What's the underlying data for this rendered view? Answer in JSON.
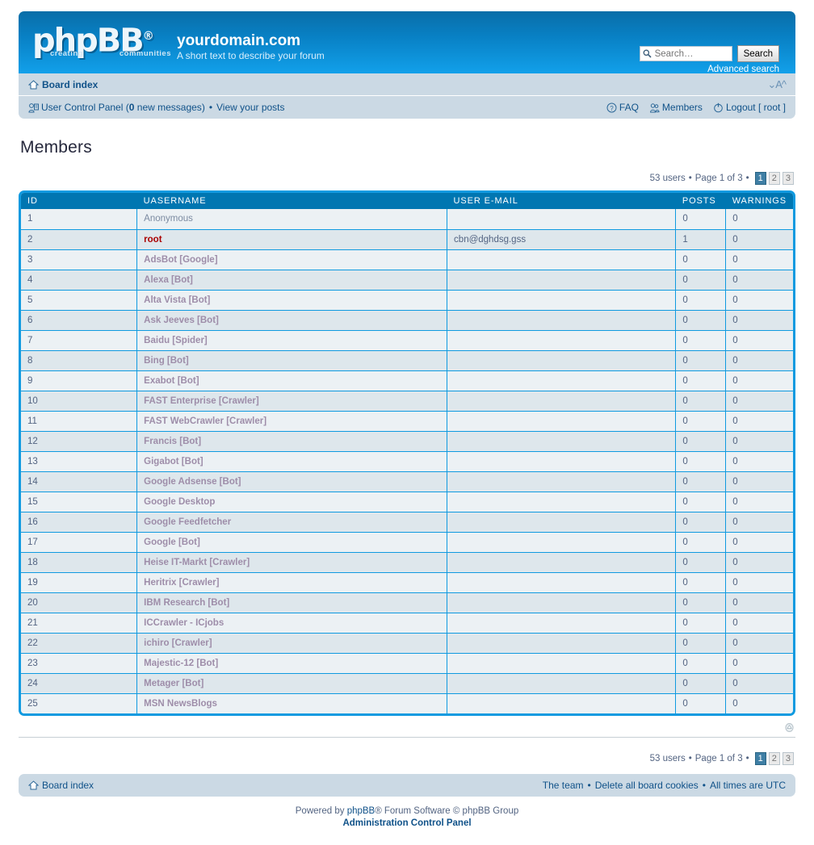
{
  "header": {
    "logo_text": "phpBB",
    "logo_reg": "®",
    "logo_sub_left": "creating",
    "logo_sub_right": "communities",
    "site_title": "yourdomain.com",
    "site_tagline": "A short text to describe your forum",
    "accent_dark": "#0076b1",
    "accent_light": "#12a0ea"
  },
  "search": {
    "placeholder": "Search…",
    "value": "",
    "button_label": "Search",
    "advanced_label": "Advanced search",
    "icon": "search-icon"
  },
  "navbar": {
    "board_index_label": "Board index",
    "home_icon": "home-icon",
    "fontsize_label": "⌄A^",
    "ucp_label": "User Control Panel",
    "ucp_new_count": "0",
    "ucp_new_text": "new messages",
    "view_posts_label": "View your posts",
    "ucp_icon": "user-control-panel-icon",
    "faq_label": "FAQ",
    "faq_icon": "question-icon",
    "members_label": "Members",
    "members_icon": "members-icon",
    "logout_label": "Logout",
    "logout_user": "[ root ]",
    "logout_icon": "power-icon",
    "separator": "•"
  },
  "main": {
    "page_title": "Members"
  },
  "pagination": {
    "users_text": "53 users",
    "page_text": "Page 1 of 3",
    "separator": "•",
    "pages": [
      "1",
      "2",
      "3"
    ],
    "active_page": "1"
  },
  "table": {
    "columns": [
      "ID",
      "UASERNAME",
      "USER E-MAIL",
      "POSTS",
      "WARNINGS"
    ],
    "rows": [
      {
        "id": "1",
        "username": "Anonymous",
        "style": "plain",
        "email": "",
        "posts": "0",
        "warnings": "0"
      },
      {
        "id": "2",
        "username": "root",
        "style": "admin",
        "email": "cbn@dghdsg.gss",
        "posts": "1",
        "warnings": "0"
      },
      {
        "id": "3",
        "username": "AdsBot [Google]",
        "style": "bot",
        "email": "",
        "posts": "0",
        "warnings": "0"
      },
      {
        "id": "4",
        "username": "Alexa [Bot]",
        "style": "bot",
        "email": "",
        "posts": "0",
        "warnings": "0"
      },
      {
        "id": "5",
        "username": "Alta Vista [Bot]",
        "style": "bot",
        "email": "",
        "posts": "0",
        "warnings": "0"
      },
      {
        "id": "6",
        "username": "Ask Jeeves [Bot]",
        "style": "bot",
        "email": "",
        "posts": "0",
        "warnings": "0"
      },
      {
        "id": "7",
        "username": "Baidu [Spider]",
        "style": "bot",
        "email": "",
        "posts": "0",
        "warnings": "0"
      },
      {
        "id": "8",
        "username": "Bing [Bot]",
        "style": "bot",
        "email": "",
        "posts": "0",
        "warnings": "0"
      },
      {
        "id": "9",
        "username": "Exabot [Bot]",
        "style": "bot",
        "email": "",
        "posts": "0",
        "warnings": "0"
      },
      {
        "id": "10",
        "username": "FAST Enterprise [Crawler]",
        "style": "bot",
        "email": "",
        "posts": "0",
        "warnings": "0"
      },
      {
        "id": "11",
        "username": "FAST WebCrawler [Crawler]",
        "style": "bot",
        "email": "",
        "posts": "0",
        "warnings": "0"
      },
      {
        "id": "12",
        "username": "Francis [Bot]",
        "style": "bot",
        "email": "",
        "posts": "0",
        "warnings": "0"
      },
      {
        "id": "13",
        "username": "Gigabot [Bot]",
        "style": "bot",
        "email": "",
        "posts": "0",
        "warnings": "0"
      },
      {
        "id": "14",
        "username": "Google Adsense [Bot]",
        "style": "bot",
        "email": "",
        "posts": "0",
        "warnings": "0"
      },
      {
        "id": "15",
        "username": "Google Desktop",
        "style": "bot",
        "email": "",
        "posts": "0",
        "warnings": "0"
      },
      {
        "id": "16",
        "username": "Google Feedfetcher",
        "style": "bot",
        "email": "",
        "posts": "0",
        "warnings": "0"
      },
      {
        "id": "17",
        "username": "Google [Bot]",
        "style": "bot",
        "email": "",
        "posts": "0",
        "warnings": "0"
      },
      {
        "id": "18",
        "username": "Heise IT-Markt [Crawler]",
        "style": "bot",
        "email": "",
        "posts": "0",
        "warnings": "0"
      },
      {
        "id": "19",
        "username": "Heritrix [Crawler]",
        "style": "bot",
        "email": "",
        "posts": "0",
        "warnings": "0"
      },
      {
        "id": "20",
        "username": "IBM Research [Bot]",
        "style": "bot",
        "email": "",
        "posts": "0",
        "warnings": "0"
      },
      {
        "id": "21",
        "username": "ICCrawler - ICjobs",
        "style": "bot",
        "email": "",
        "posts": "0",
        "warnings": "0"
      },
      {
        "id": "22",
        "username": "ichiro [Crawler]",
        "style": "bot",
        "email": "",
        "posts": "0",
        "warnings": "0"
      },
      {
        "id": "23",
        "username": "Majestic-12 [Bot]",
        "style": "bot",
        "email": "",
        "posts": "0",
        "warnings": "0"
      },
      {
        "id": "24",
        "username": "Metager [Bot]",
        "style": "bot",
        "email": "",
        "posts": "0",
        "warnings": "0"
      },
      {
        "id": "25",
        "username": "MSN NewsBlogs",
        "style": "bot",
        "email": "",
        "posts": "0",
        "warnings": "0"
      }
    ]
  },
  "to_top": {
    "icon": "back-to-top-icon"
  },
  "footer": {
    "board_index_label": "Board index",
    "home_icon": "home-icon",
    "the_team_label": "The team",
    "delete_cookies_label": "Delete all board cookies",
    "timezone_label": "All times are UTC",
    "separator": "•",
    "powered_prefix": "Powered by",
    "powered_link": "phpBB",
    "powered_suffix": "® Forum Software © phpBB Group",
    "acp_label": "Administration Control Panel"
  }
}
